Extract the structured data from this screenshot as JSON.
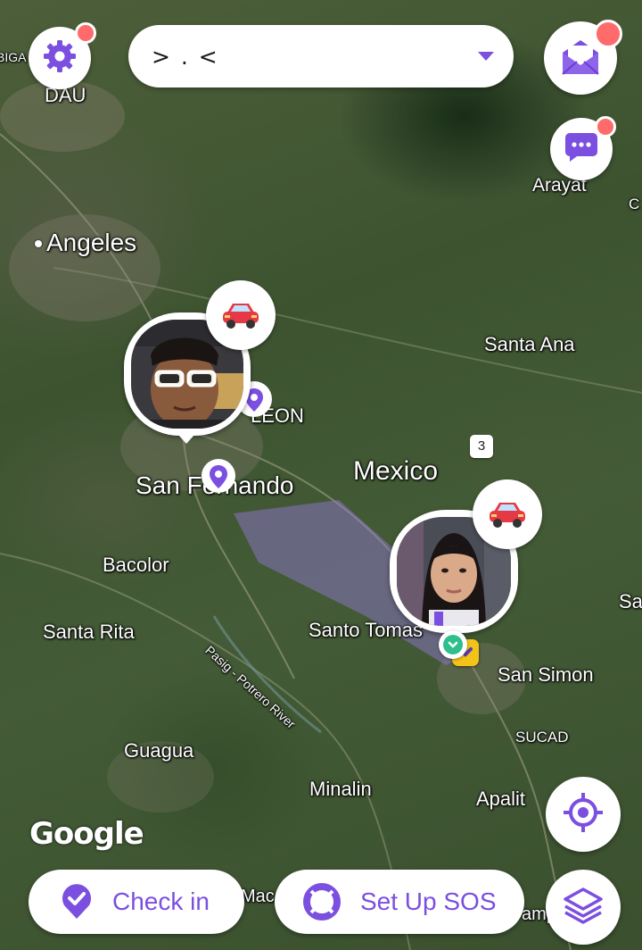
{
  "header": {
    "circle_name": "> . <"
  },
  "map": {
    "labels": {
      "biga": "BIGA",
      "dau": "DAU",
      "arayat": "Arayat",
      "c": "C",
      "angeles": "Angeles",
      "santa_ana": "Santa Ana",
      "leon": "LEON",
      "mexico": "Mexico",
      "san_fernando": "San Fernando",
      "bacolor": "Bacolor",
      "sa": "Sa",
      "santa_rita": "Santa Rita",
      "santo_tomas": "Santo Tomas",
      "san_simon": "San Simon",
      "sucad": "SUCAD",
      "guagua": "Guagua",
      "minalin": "Minalin",
      "apalit": "Apalit",
      "river": "Pasig - Potrero River",
      "mac": "Mac",
      "amp": "amp"
    },
    "route_shield": "3",
    "attribution": "Google"
  },
  "actions": {
    "check_in_label": "Check in",
    "sos_label": "Set Up SOS"
  },
  "colors": {
    "accent": "#7b4fe0",
    "badge": "#ff6b6b",
    "status_green": "#2fbf8c",
    "marker_yellow": "#f2c318"
  },
  "icons": {
    "settings": "gear-icon",
    "mail": "mail-icon",
    "chat": "chat-icon",
    "locate": "crosshair-icon",
    "layers": "layers-icon",
    "check_in": "check-pin-icon",
    "sos": "lifebuoy-icon"
  }
}
